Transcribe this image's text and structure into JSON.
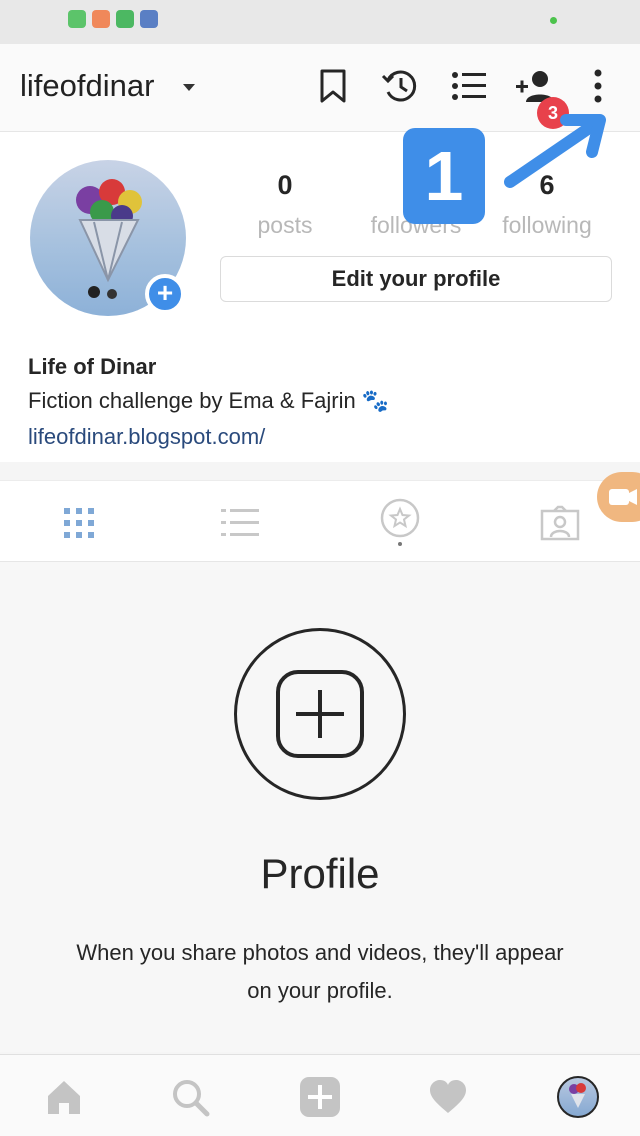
{
  "top_bar": {
    "username": "lifeofdinar",
    "notification_count": "3",
    "icons": [
      "bookmark-icon",
      "history-icon",
      "list-icon",
      "add-person-icon",
      "more-vertical-icon"
    ]
  },
  "profile": {
    "stats": {
      "posts": {
        "count": "0",
        "label": "posts"
      },
      "followers": {
        "count": "",
        "label": "followers"
      },
      "following": {
        "count": "6",
        "label": "following"
      }
    },
    "edit_button": "Edit your profile",
    "name": "Life of Dinar",
    "bio": "Fiction challenge by Ema & Fajrin 🐾",
    "link": "lifeofdinar.blogspot.com/"
  },
  "tutorial": {
    "step": "1"
  },
  "tabs": [
    "grid-icon",
    "list-icon",
    "tagged-icon",
    "photos-of-you-icon"
  ],
  "empty_state": {
    "title": "Profile",
    "description": "When you share photos and videos, they'll appear on your profile."
  },
  "bottom_nav": [
    "home-icon",
    "search-icon",
    "add-post-icon",
    "heart-icon",
    "profile-avatar"
  ],
  "colors": {
    "accent_blue": "#3f8ee8",
    "badge_red": "#e8414b",
    "link": "#2a4a7c"
  }
}
